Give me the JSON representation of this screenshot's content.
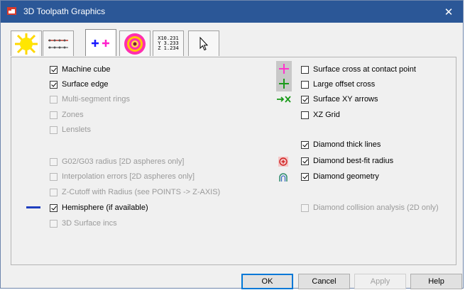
{
  "window": {
    "title": "3D Toolpath Graphics",
    "close_glyph": "✕",
    "title_color": "#2b5797"
  },
  "tabs": [
    {
      "name": "tab-lighting",
      "icon": "sun-icon"
    },
    {
      "name": "tab-toolpath-lines",
      "icon": "dotted-lines-icon"
    },
    {
      "name": "tab-crosses",
      "icon": "cross-markers-icon",
      "active": true
    },
    {
      "name": "tab-rings",
      "icon": "concentric-rings-icon"
    },
    {
      "name": "tab-coordinates",
      "icon": "xyz-readout-icon",
      "text_lines": [
        "X10.231",
        "Y 3.233",
        "Z 1.234"
      ]
    },
    {
      "name": "tab-pointer",
      "icon": "cursor-arrow-icon"
    }
  ],
  "left_options": [
    {
      "label": "Machine cube",
      "checked": true,
      "enabled": true
    },
    {
      "label": "Surface edge",
      "checked": true,
      "enabled": true
    },
    {
      "label": "Multi-segment rings",
      "checked": false,
      "enabled": false
    },
    {
      "label": "Zones",
      "checked": false,
      "enabled": false
    },
    {
      "label": "Lenslets",
      "checked": false,
      "enabled": false
    },
    {
      "label": "G02/G03 radius [2D aspheres only]",
      "checked": false,
      "enabled": false
    },
    {
      "label": "Interpolation errors [2D aspheres only]",
      "checked": false,
      "enabled": false
    },
    {
      "label": "Z-Cutoff with Radius (see POINTS -> Z-AXIS)",
      "checked": false,
      "enabled": false
    },
    {
      "label": "Hemisphere (if available)",
      "checked": true,
      "enabled": true
    },
    {
      "label": "3D Surface incs",
      "checked": false,
      "enabled": false
    }
  ],
  "right_options": [
    {
      "label": "Surface cross at contact point",
      "checked": false,
      "enabled": true
    },
    {
      "label": "Large offset cross",
      "checked": false,
      "enabled": true
    },
    {
      "label": "Surface XY arrows",
      "checked": true,
      "enabled": true
    },
    {
      "label": "XZ Grid",
      "checked": false,
      "enabled": true
    },
    {
      "label": "Diamond thick lines",
      "checked": true,
      "enabled": true
    },
    {
      "label": "Diamond best-fit radius",
      "checked": true,
      "enabled": true
    },
    {
      "label": "Diamond geometry",
      "checked": true,
      "enabled": true
    },
    {
      "label": "Diamond collision analysis (2D only)",
      "checked": false,
      "enabled": false
    }
  ],
  "buttons": {
    "ok": "OK",
    "cancel": "Cancel",
    "apply": "Apply",
    "help": "Help"
  },
  "colors": {
    "magenta_cross": "#ff33cc",
    "green_cross": "#1a9a1a",
    "hemisphere_line": "#1f3fbf",
    "focus_border": "#0078d7"
  }
}
